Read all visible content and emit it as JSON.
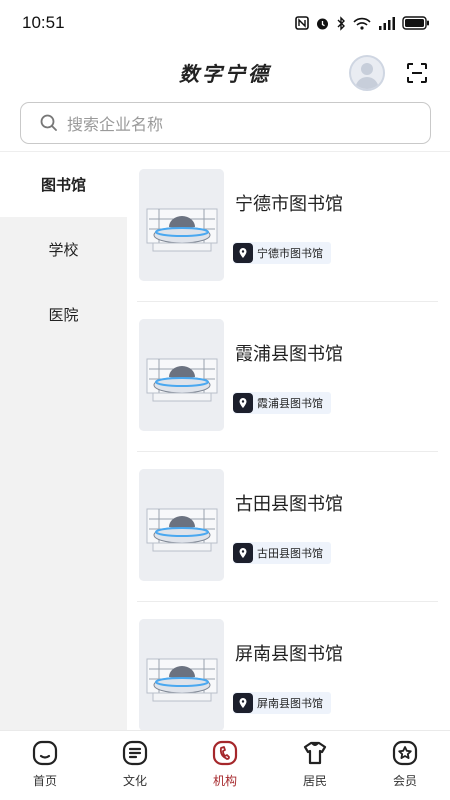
{
  "status_bar": {
    "time": "10:51"
  },
  "header": {
    "title": "数字宁德"
  },
  "search": {
    "placeholder": "搜索企业名称"
  },
  "sidebar": {
    "items": [
      {
        "label": "图书馆",
        "active": true
      },
      {
        "label": "学校",
        "active": false
      },
      {
        "label": "医院",
        "active": false
      }
    ]
  },
  "list": {
    "items": [
      {
        "title": "宁德市图书馆",
        "tag": "宁德市图书馆"
      },
      {
        "title": "霞浦县图书馆",
        "tag": "霞浦县图书馆"
      },
      {
        "title": "古田县图书馆",
        "tag": "古田县图书馆"
      },
      {
        "title": "屏南县图书馆",
        "tag": "屏南县图书馆"
      }
    ]
  },
  "tabbar": {
    "tabs": [
      {
        "label": "首页",
        "icon": "home-icon"
      },
      {
        "label": "文化",
        "icon": "culture-icon"
      },
      {
        "label": "机构",
        "icon": "institution-icon",
        "active": true
      },
      {
        "label": "居民",
        "icon": "resident-icon"
      },
      {
        "label": "会员",
        "icon": "member-icon"
      }
    ]
  },
  "colors": {
    "accent": "#a5272b",
    "sidebar_bg": "#f2f2f2",
    "tag_bg": "#eef3fb"
  }
}
